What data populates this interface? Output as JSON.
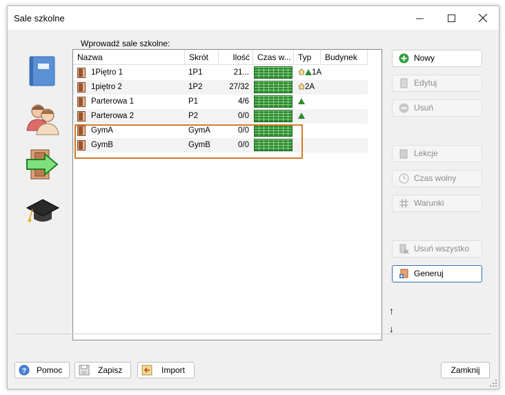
{
  "window": {
    "title": "Sale szkolne",
    "minimize_icon": "minimize-icon",
    "maximize_icon": "maximize-icon",
    "close_icon": "close-icon"
  },
  "left_toolbar": [
    {
      "name": "book-icon"
    },
    {
      "name": "teachers-icon"
    },
    {
      "name": "classroom-door-arrow-icon"
    },
    {
      "name": "graduation-cap-icon"
    }
  ],
  "prompt": "Wprowadź sale szkolne:",
  "table": {
    "columns": [
      "Nazwa",
      "Skrót",
      "Ilość",
      "Czas w...",
      "Typ",
      "Budynek"
    ],
    "rows": [
      {
        "name": "1Piętro 1",
        "short": "1P1",
        "count": "21...",
        "type_icons": "house-tree",
        "type_text": "1A",
        "building": ""
      },
      {
        "name": "1piętro 2",
        "short": "1P2",
        "count": "27/32",
        "type_icons": "house",
        "type_text": "2A",
        "building": ""
      },
      {
        "name": "Parterowa 1",
        "short": "P1",
        "count": "4/6",
        "type_icons": "tree",
        "type_text": "",
        "building": ""
      },
      {
        "name": "Parterowa 2",
        "short": "P2",
        "count": "0/0",
        "type_icons": "tree",
        "type_text": "",
        "building": ""
      },
      {
        "name": "GymA",
        "short": "GymA",
        "count": "0/0",
        "type_icons": "",
        "type_text": "",
        "building": ""
      },
      {
        "name": "GymB",
        "short": "GymB",
        "count": "0/0",
        "type_icons": "",
        "type_text": "",
        "building": ""
      }
    ]
  },
  "right_buttons": {
    "new": "Nowy",
    "edit": "Edytuj",
    "delete": "Usuń",
    "lessons": "Lekcje",
    "free_time": "Czas wolny",
    "conditions": "Warunki",
    "delete_all": "Usuń wszystko",
    "generate": "Generuj"
  },
  "move_up": "↑",
  "move_down": "↓",
  "bottom_buttons": {
    "help": "Pomoc",
    "save": "Zapisz",
    "import": "Import",
    "close": "Zamknij"
  },
  "colors": {
    "selection_border": "#d07a2a",
    "time_grid_green": "#2e8b2e",
    "focus_border": "#2f6fb5"
  }
}
